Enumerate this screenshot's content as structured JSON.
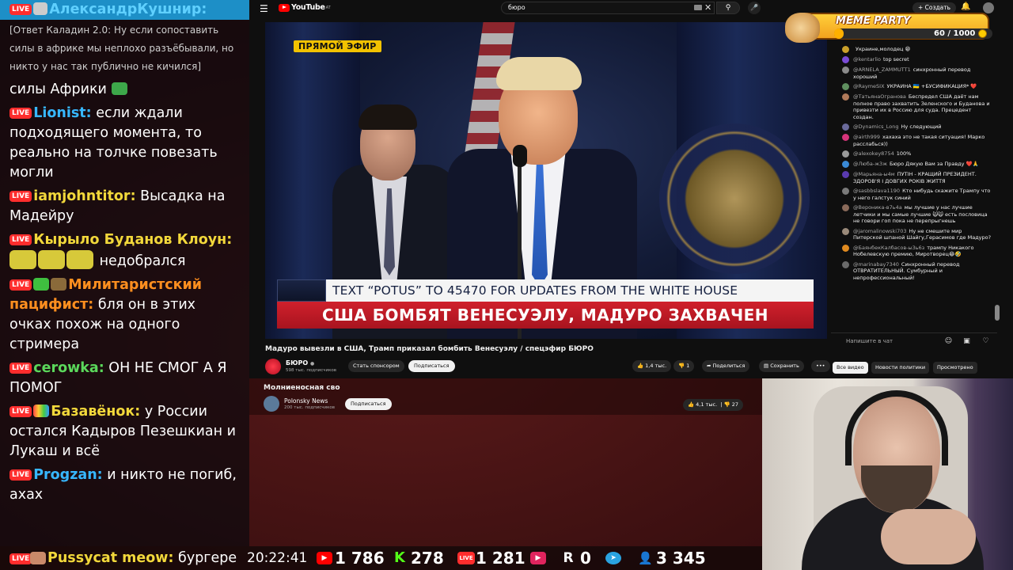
{
  "stream_chat": {
    "messages": [
      {
        "user": "АлександрКушнир:",
        "text": "",
        "user_color": "#37b7ff",
        "badge": "LIVE",
        "highlight": true
      },
      {
        "user": "",
        "text": "[Ответ Каладин 2.0: Ну если сопоставить силы в африке мы неплохо разъёбывали, но никто у нас так публично не кичился]",
        "grey": true
      },
      {
        "user": "",
        "text": "силы Африки",
        "emote": true
      },
      {
        "user": "Lionist:",
        "text": "если ждали подходящего момента, то реально  на толчке повезать могли",
        "user_color": "#37b7ff",
        "badge": "LIVE"
      },
      {
        "user": "iamjohntitor:",
        "text": "Высадка на Мадейру",
        "user_color": "#f2d83b",
        "badge": "LIVE"
      },
      {
        "user": "Кырыло Буданов Клоун:",
        "text": "недобрался",
        "user_color": "#f2d83b",
        "badge": "LIVE",
        "emotes_prefix": 3
      },
      {
        "user": "Милитаристский пацифист:",
        "text": "бля он в этих очках похож на одного стримера",
        "user_color": "#ff8f1f",
        "badge": "LIVE",
        "emote": false,
        "prefix_emotes": 2
      },
      {
        "user": "cerowka:",
        "text": "ОН НЕ СМОГ А Я ПОМОГ",
        "user_color": "#5bd85b",
        "badge": "LIVE"
      },
      {
        "user": "Базавёнок:",
        "text": "у России остался Кадыров Пезешкиан и Лукаш и всё",
        "user_color": "#f2d83b",
        "badge": "LIVE",
        "prefix_emotes": 1
      },
      {
        "user": "Progzan:",
        "text": "и никто не погиб, ахах",
        "user_color": "#37b7ff",
        "badge": "LIVE"
      }
    ]
  },
  "youtube": {
    "logo_text": "YouTube",
    "logo_region": "AT",
    "search_value": "бюро",
    "create_label": "Создать",
    "player": {
      "live_label": "ПРЯМОЙ ЭФИР",
      "ticker_line1": "TEXT “POTUS” TO 45470 FOR UPDATES FROM THE WHITE HOUSE",
      "ticker_line2": "США БОМБЯТ ВЕНЕСУЭЛУ, МАДУРО ЗАХВАЧЕН"
    },
    "video": {
      "title": "Мадуро вывезли в США, Трамп приказал бомбить Венесуэлу / спецэфир БЮРО",
      "channel": "БЮРО",
      "subscribers": "598 тыс. подписчиков",
      "sponsor_label": "Стать спонсором",
      "subscribe_label": "Подписаться",
      "likes": "1,4 тыс.",
      "dislikes": "1",
      "share_label": "Поделиться",
      "save_label": "Сохранить",
      "more_label": "•••"
    },
    "filters": [
      "Все видео",
      "Новости политики",
      "Просмотрено"
    ],
    "chat_placeholder": "Напишите в чат",
    "live_chat": [
      {
        "user": "",
        "text": "Украине,молодец 😁",
        "color": "#caa02a"
      },
      {
        "user": "@kentarlio",
        "text": "top secret",
        "color": "#7a4bd6"
      },
      {
        "user": "@ARNELA_ZAMMUTT1",
        "text": "синхронный перевод хороший",
        "color": "#8a8a8a"
      },
      {
        "user": "@RaymeSIX",
        "text": "УКРАИНА 🇺🇦 +БУСИФИКАЦИЯ* ❤️",
        "color": "#5f8f5f"
      },
      {
        "user": "@ТатьянаОгранова",
        "text": "Беспредел США даёт нам полное право захватить Зеленского и Буданова и привезти их в Россию для суда. Прецедент создан.",
        "color": "#b07a5a"
      },
      {
        "user": "@Dynamics_Long",
        "text": "Ну следующий",
        "color": "#6a6a9a"
      },
      {
        "user": "@airth999",
        "text": "хахаха это не такая ситуация! Марко расслабься))",
        "color": "#d6347a"
      },
      {
        "user": "@alexokey8754",
        "text": "100%",
        "color": "#9a9a9a"
      },
      {
        "user": "@Люба-ж3ж",
        "text": "Бюро Дякую Вам за Правду ❤️🙏",
        "color": "#3a8ad6"
      },
      {
        "user": "@Марьяна-ы4м",
        "text": "ПУТІН - КРАЩИЙ ПРЕЗИДЕНТ. ЗДОРОВ'Я І ДОВГИХ РОКІВ ЖИТТЯ",
        "color": "#5a3ab0"
      },
      {
        "user": "@sasbbslava1190",
        "text": "Кто нибудь скажите Трампу что у него галстук синий",
        "color": "#7a7a7a"
      },
      {
        "user": "@Вероника-в7ь4а",
        "text": "мы лучшие у нас лучшие летчики и мы самые лучшие 🙀🙀 есть пословица не говори гоп пока не перепрыгнешь",
        "color": "#8a6a5a"
      },
      {
        "user": "@jaromalinowski703",
        "text": "Ну не смешите мир Питерской шпаной Шайгу,Герасимов где Мадуро?",
        "color": "#9a8a7a"
      },
      {
        "user": "@БаянбекКалбасов-ы3ь6з",
        "text": "трампу Никакого Нобелевскую премию, Миротворец😂🤣",
        "color": "#e08a20"
      },
      {
        "user": "@marinabay7340",
        "text": "Синхронный перевод ОТВРАТИТЕЛЬНЫЙ. Сумбурный и непрофессиональный!",
        "color": "#6a6a6a"
      }
    ],
    "next_stream": {
      "title": "Молниеносная сво",
      "channel": "Polonsky News",
      "subscribers": "200 тыс. подписчиков",
      "subscribe_label": "Подписаться",
      "likes": "4,1 тыс.",
      "dislikes": "27"
    }
  },
  "meme_party": {
    "title": "MEME PARTY",
    "count_text": "60 / 1000",
    "progress_fraction": 0.06
  },
  "stats_bar": {
    "last_user": "Pussycat meow:",
    "last_text": "бургере",
    "time": "20:22:41",
    "youtube_viewers": "1 786",
    "kick_viewers": "278",
    "vk_viewers": "1 281",
    "rutube_viewers": "0",
    "telegram_viewers": "",
    "total_viewers": "3 345",
    "colors": {
      "youtube": "#ff0000",
      "kick": "#53fc18",
      "vk_live": "#ff2d2d",
      "rutube": "#ffffff",
      "telegram": "#2aa3e0",
      "total": "#7fc4ff"
    }
  }
}
